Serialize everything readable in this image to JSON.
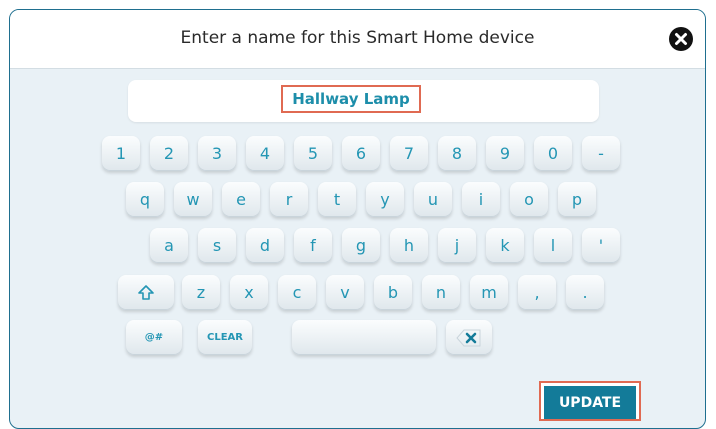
{
  "dialog": {
    "title": "Enter a name for this Smart Home device",
    "device_name": "Hallway Lamp",
    "update_label": "UPDATE"
  },
  "keyboard": {
    "row1": [
      "1",
      "2",
      "3",
      "4",
      "5",
      "6",
      "7",
      "8",
      "9",
      "0",
      "-"
    ],
    "row2": [
      "q",
      "w",
      "e",
      "r",
      "t",
      "y",
      "u",
      "i",
      "o",
      "p"
    ],
    "row3": [
      "a",
      "s",
      "d",
      "f",
      "g",
      "h",
      "j",
      "k",
      "l",
      "'"
    ],
    "row4": [
      "z",
      "x",
      "c",
      "v",
      "b",
      "n",
      "m",
      ",",
      "."
    ],
    "symbols_label": "@#",
    "clear_label": "CLEAR"
  },
  "colors": {
    "accent": "#137b99",
    "key_text": "#2496b4",
    "highlight": "#e06a52"
  }
}
